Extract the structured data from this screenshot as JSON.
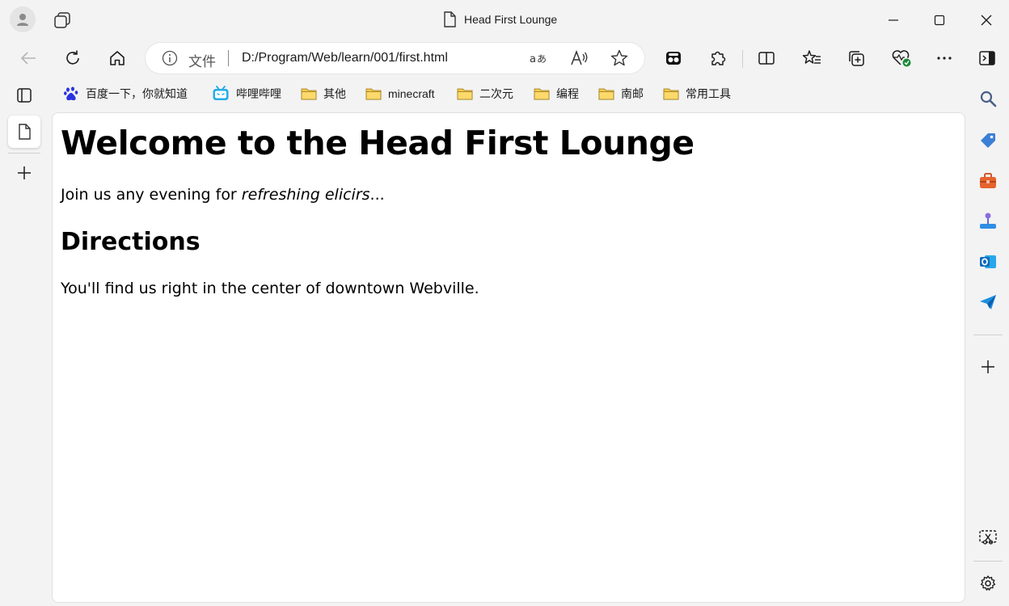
{
  "window": {
    "tab_title": "Head First Lounge"
  },
  "addressbar": {
    "scheme_label": "文件",
    "url": "D:/Program/Web/learn/001/first.html"
  },
  "favorites": [
    {
      "label": "百度一下，你就知道",
      "icon": "baidu-icon"
    },
    {
      "label": "哔哩哔哩",
      "icon": "bilibili-icon"
    },
    {
      "label": "其他",
      "icon": "folder-icon"
    },
    {
      "label": "minecraft",
      "icon": "folder-icon"
    },
    {
      "label": "二次元",
      "icon": "folder-icon"
    },
    {
      "label": "编程",
      "icon": "folder-icon"
    },
    {
      "label": "南邮",
      "icon": "folder-icon"
    },
    {
      "label": "常用工具",
      "icon": "folder-icon"
    }
  ],
  "page": {
    "heading": "Welcome to the Head First Lounge",
    "intro_text": "Join us any evening for ",
    "intro_emphasis": "refreshing elicirs",
    "intro_suffix": "...",
    "subheading": "Directions",
    "directions_text": "You'll find us right in the center of downtown Webville."
  },
  "colors": {
    "folder": "#f5c84c",
    "baidu": "#2932e1",
    "bilibili": "#23ade5",
    "edge_blue": "#0f6cbd"
  }
}
